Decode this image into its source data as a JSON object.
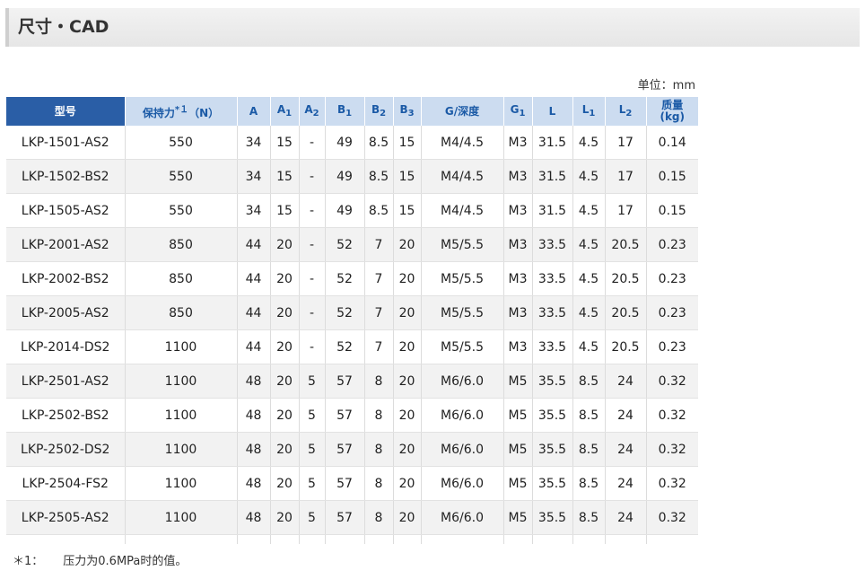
{
  "section": {
    "title": "尺寸・CAD"
  },
  "unit_note": "单位：mm",
  "table": {
    "headers": {
      "model": "型号",
      "holding_force_a": "保持力",
      "holding_force_note": "*１",
      "holding_force_b": "（N）",
      "A": "A",
      "A1": "A",
      "A1_sub": "1",
      "A2": "A",
      "A2_sub": "2",
      "B1": "B",
      "B1_sub": "1",
      "B2": "B",
      "B2_sub": "2",
      "B3": "B",
      "B3_sub": "3",
      "G_depth": "G/深度",
      "G1": "G",
      "G1_sub": "1",
      "L": "L",
      "L1": "L",
      "L1_sub": "1",
      "L2": "L",
      "L2_sub": "2",
      "mass_a": "质量",
      "mass_b": "(kg)"
    },
    "rows": [
      [
        "LKP-1501-AS2",
        "550",
        "34",
        "15",
        "-",
        "49",
        "8.5",
        "15",
        "M4/4.5",
        "M3",
        "31.5",
        "4.5",
        "17",
        "0.14"
      ],
      [
        "LKP-1502-BS2",
        "550",
        "34",
        "15",
        "-",
        "49",
        "8.5",
        "15",
        "M4/4.5",
        "M3",
        "31.5",
        "4.5",
        "17",
        "0.15"
      ],
      [
        "LKP-1505-AS2",
        "550",
        "34",
        "15",
        "-",
        "49",
        "8.5",
        "15",
        "M4/4.5",
        "M3",
        "31.5",
        "4.5",
        "17",
        "0.15"
      ],
      [
        "LKP-2001-AS2",
        "850",
        "44",
        "20",
        "-",
        "52",
        "7",
        "20",
        "M5/5.5",
        "M3",
        "33.5",
        "4.5",
        "20.5",
        "0.23"
      ],
      [
        "LKP-2002-BS2",
        "850",
        "44",
        "20",
        "-",
        "52",
        "7",
        "20",
        "M5/5.5",
        "M3",
        "33.5",
        "4.5",
        "20.5",
        "0.23"
      ],
      [
        "LKP-2005-AS2",
        "850",
        "44",
        "20",
        "-",
        "52",
        "7",
        "20",
        "M5/5.5",
        "M3",
        "33.5",
        "4.5",
        "20.5",
        "0.23"
      ],
      [
        "LKP-2014-DS2",
        "1100",
        "44",
        "20",
        "-",
        "52",
        "7",
        "20",
        "M5/5.5",
        "M3",
        "33.5",
        "4.5",
        "20.5",
        "0.23"
      ],
      [
        "LKP-2501-AS2",
        "1100",
        "48",
        "20",
        "5",
        "57",
        "8",
        "20",
        "M6/6.0",
        "M5",
        "35.5",
        "8.5",
        "24",
        "0.32"
      ],
      [
        "LKP-2502-BS2",
        "1100",
        "48",
        "20",
        "5",
        "57",
        "8",
        "20",
        "M6/6.0",
        "M5",
        "35.5",
        "8.5",
        "24",
        "0.32"
      ],
      [
        "LKP-2502-DS2",
        "1100",
        "48",
        "20",
        "5",
        "57",
        "8",
        "20",
        "M6/6.0",
        "M5",
        "35.5",
        "8.5",
        "24",
        "0.32"
      ],
      [
        "LKP-2504-FS2",
        "1100",
        "48",
        "20",
        "5",
        "57",
        "8",
        "20",
        "M6/6.0",
        "M5",
        "35.5",
        "8.5",
        "24",
        "0.32"
      ],
      [
        "LKP-2505-AS2",
        "1100",
        "48",
        "20",
        "5",
        "57",
        "8",
        "20",
        "M6/6.0",
        "M5",
        "35.5",
        "8.5",
        "24",
        "0.32"
      ]
    ]
  },
  "footnote": {
    "mark": "＊1：",
    "text": "压力为0.6MPa时的值。"
  }
}
